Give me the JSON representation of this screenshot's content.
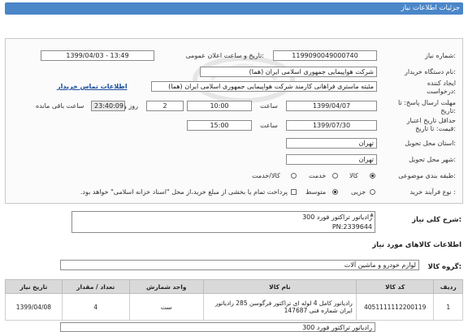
{
  "page": {
    "title": "جزئیات اطلاعات نیاز"
  },
  "need_number": {
    "label": "شماره نیاز:",
    "value": "1199090049000740"
  },
  "announce_datetime": {
    "label": "تاریخ و ساعت اعلان عمومی:",
    "value": "1399/04/03 - 13:49"
  },
  "buyer_org": {
    "label": "نام دستگاه خریدار:",
    "value": "شرکت هواپیمایی جمهوری اسلامی ایران (هما)"
  },
  "creator": {
    "label": "ایجاد کننده درخواست:",
    "value": "مئیته ماستری فراهانی کارمند شرکت هواپیمایی جمهوری اسلامی ایران (هما)",
    "contact_link": "اطلاعات تماس خریدار"
  },
  "response_deadline": {
    "label": "مهلت ارسال پاسخ: تا تاریخ:",
    "date": "1399/04/07",
    "time_label": "ساعت",
    "time": "10:00",
    "days": "2",
    "days_label": "روز و",
    "remaining": "23:40:09",
    "remaining_label": "ساعت باقی مانده"
  },
  "price_validity": {
    "label": "حداقل تاریخ اعتبار قیمت: تا تاریخ:",
    "date": "1399/07/30",
    "time_label": "ساعت",
    "time": "15:00"
  },
  "delivery_province": {
    "label": "استان محل تحویل:",
    "value": "تهران"
  },
  "delivery_city": {
    "label": "شهر محل تحویل:",
    "value": "تهران"
  },
  "subject_class": {
    "label": "طبقه بندی موضوعی:",
    "options": [
      "کالا",
      "خدمت",
      "کالا/خدمت"
    ],
    "selected": "کالا"
  },
  "process_type": {
    "label": "نوع فرآیند خرید :",
    "options": [
      "جزیی",
      "متوسط"
    ],
    "selected": "متوسط",
    "note": "پرداخت تمام یا بخشی از مبلغ خرید،از محل \"اسناد خزانه اسلامی\" خواهد بود."
  },
  "summary": {
    "label": "شرح کلی نیاز:",
    "line1": "رادیاتور تراکتور فورد 300",
    "line2": "PN:2339644"
  },
  "goods_info": {
    "title": "اطلاعات کالاهای مورد نیاز"
  },
  "goods_group": {
    "label": "گروه کالا:",
    "value": "لوازم خودرو و ماشین آلات"
  },
  "table": {
    "headers": [
      "ردیف",
      "کد کالا",
      "نام کالا",
      "واحد شمارش",
      "تعداد / مقدار",
      "تاریخ نیاز"
    ],
    "rows": [
      {
        "row": "1",
        "code": "4051111112200119",
        "name": "رادیاتور کامل 4 لوله ای تراکتور فرگوسن 285 رادیاتور ایران شماره فنی 147687",
        "unit": "ست",
        "qty": "4",
        "date": "1399/04/08"
      }
    ]
  },
  "bottom_note": "رادیاتور تراکتور فورد 300"
}
